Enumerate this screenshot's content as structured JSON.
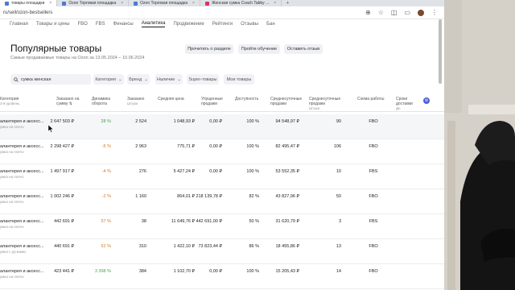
{
  "browser": {
    "tabs": [
      {
        "label": "товары площадки",
        "active": true
      },
      {
        "label": "Ozon Торговая площадка",
        "active": false
      },
      {
        "label": "Ozon Торговая площадка",
        "active": false
      },
      {
        "label": "Женская сумка Coach Tabby ...",
        "active": false
      }
    ],
    "url": "ru/sell/ozon-bestsellers"
  },
  "nav": [
    "Главная",
    "Товары и цены",
    "FBO",
    "FBS",
    "Финансы",
    "Аналитика",
    "Продвижение",
    "Рейтинги",
    "Отзывы",
    "Бан"
  ],
  "nav_active_index": 5,
  "page": {
    "title": "Популярные товары",
    "subtitle": "Самые продаваемые товары на Ozon за 13.05.2024 – 10.06.2024",
    "btn_read": "Прочитать о разделе",
    "btn_training": "Пройти обучение",
    "btn_feedback": "Оставить отзыв"
  },
  "filters": {
    "search_value": "сумка женская",
    "category": "Категория",
    "brand": "Бренд",
    "availability": "Наличие",
    "super": "Super-товары",
    "my": "Мои товары"
  },
  "table": {
    "columns": [
      {
        "label": "Категория",
        "sub": "3-й уровень"
      },
      {
        "label": "Заказано на сумму",
        "sub": ""
      },
      {
        "label": "Динамика оборота",
        "sub": ""
      },
      {
        "label": "Заказано",
        "sub": "Штуки"
      },
      {
        "label": "Средняя цена",
        "sub": ""
      },
      {
        "label": "Упущенные продажи",
        "sub": ""
      },
      {
        "label": "Доступность",
        "sub": ""
      },
      {
        "label": "Среднесуточные продажи",
        "sub": ""
      },
      {
        "label": "Среднесуточные продажи",
        "sub": "Штуки"
      },
      {
        "label": "Схема работы",
        "sub": ""
      },
      {
        "label": "Сроки доставки",
        "sub": "Дн"
      }
    ],
    "rows": [
      {
        "cat": "алантерея и аксесс...",
        "sub": "умка на плечо",
        "sum": "2 647 503 ₽",
        "dyn": "28 %",
        "dyn_type": "pos",
        "qty": "2 524",
        "price": "1 048,93 ₽",
        "lost": "0,00 ₽",
        "avail": "100 %",
        "daily": "94 548,97 ₽",
        "daily_qty": "90",
        "scheme": "FBO"
      },
      {
        "cat": "алантерея и аксесс...",
        "sub": "умка на плечо",
        "sum": "2 298 427 ₽",
        "dyn": "-5 %",
        "dyn_type": "neg",
        "qty": "2 963",
        "price": "775,71 ₽",
        "lost": "0,00 ₽",
        "avail": "100 %",
        "daily": "82 495,47 ₽",
        "daily_qty": "106",
        "scheme": "FBO"
      },
      {
        "cat": "алантерея и аксесс...",
        "sub": "умка на плечо",
        "sum": "1 497 917 ₽",
        "dyn": "-4 %",
        "dyn_type": "neg",
        "qty": "276",
        "price": "5 427,24 ₽",
        "lost": "0,00 ₽",
        "avail": "100 %",
        "daily": "53 552,35 ₽",
        "daily_qty": "10",
        "scheme": "FBS"
      },
      {
        "cat": "алантерея и аксесс...",
        "sub": "умка на плечо",
        "sum": "1 002 246 ₽",
        "dyn": "-2 %",
        "dyn_type": "neg",
        "qty": "1 160",
        "price": "864,01 ₽",
        "lost": "218 139,78 ₽",
        "avail": "82 %",
        "daily": "43 827,96 ₽",
        "daily_qty": "50",
        "scheme": "FBO"
      },
      {
        "cat": "алантерея и аксесс...",
        "sub": "умка на плечо",
        "sum": "442 691 ₽",
        "dyn": "57 %",
        "dyn_type": "neg",
        "qty": "38",
        "price": "11 649,76 ₽",
        "lost": "442 691,00 ₽",
        "avail": "50 %",
        "daily": "31 620,79 ₽",
        "daily_qty": "3",
        "scheme": "FBS"
      },
      {
        "cat": "алантерея и аксесс...",
        "sub": "умка с ручками",
        "sum": "440 691 ₽",
        "dyn": "52 %",
        "dyn_type": "neg",
        "qty": "310",
        "price": "1 422,10 ₽",
        "lost": "73 823,44 ₽",
        "avail": "86 %",
        "daily": "18 455,86 ₽",
        "daily_qty": "13",
        "scheme": "FBO"
      },
      {
        "cat": "алантерея и аксесс...",
        "sub": "умка на плечо",
        "sum": "423 441 ₽",
        "dyn": "3 398 %",
        "dyn_type": "pos",
        "qty": "384",
        "price": "1 102,70 ₽",
        "lost": "0,00 ₽",
        "avail": "100 %",
        "daily": "15 205,43 ₽",
        "daily_qty": "14",
        "scheme": "FBO"
      }
    ]
  },
  "colors": {
    "accent": "#4a5fd6",
    "positive": "#4ba24b",
    "negative": "#d57a24"
  },
  "icons": [
    "search-icon",
    "chevron-down-icon",
    "gear-icon",
    "sort-icon",
    "cursor-icon"
  ]
}
